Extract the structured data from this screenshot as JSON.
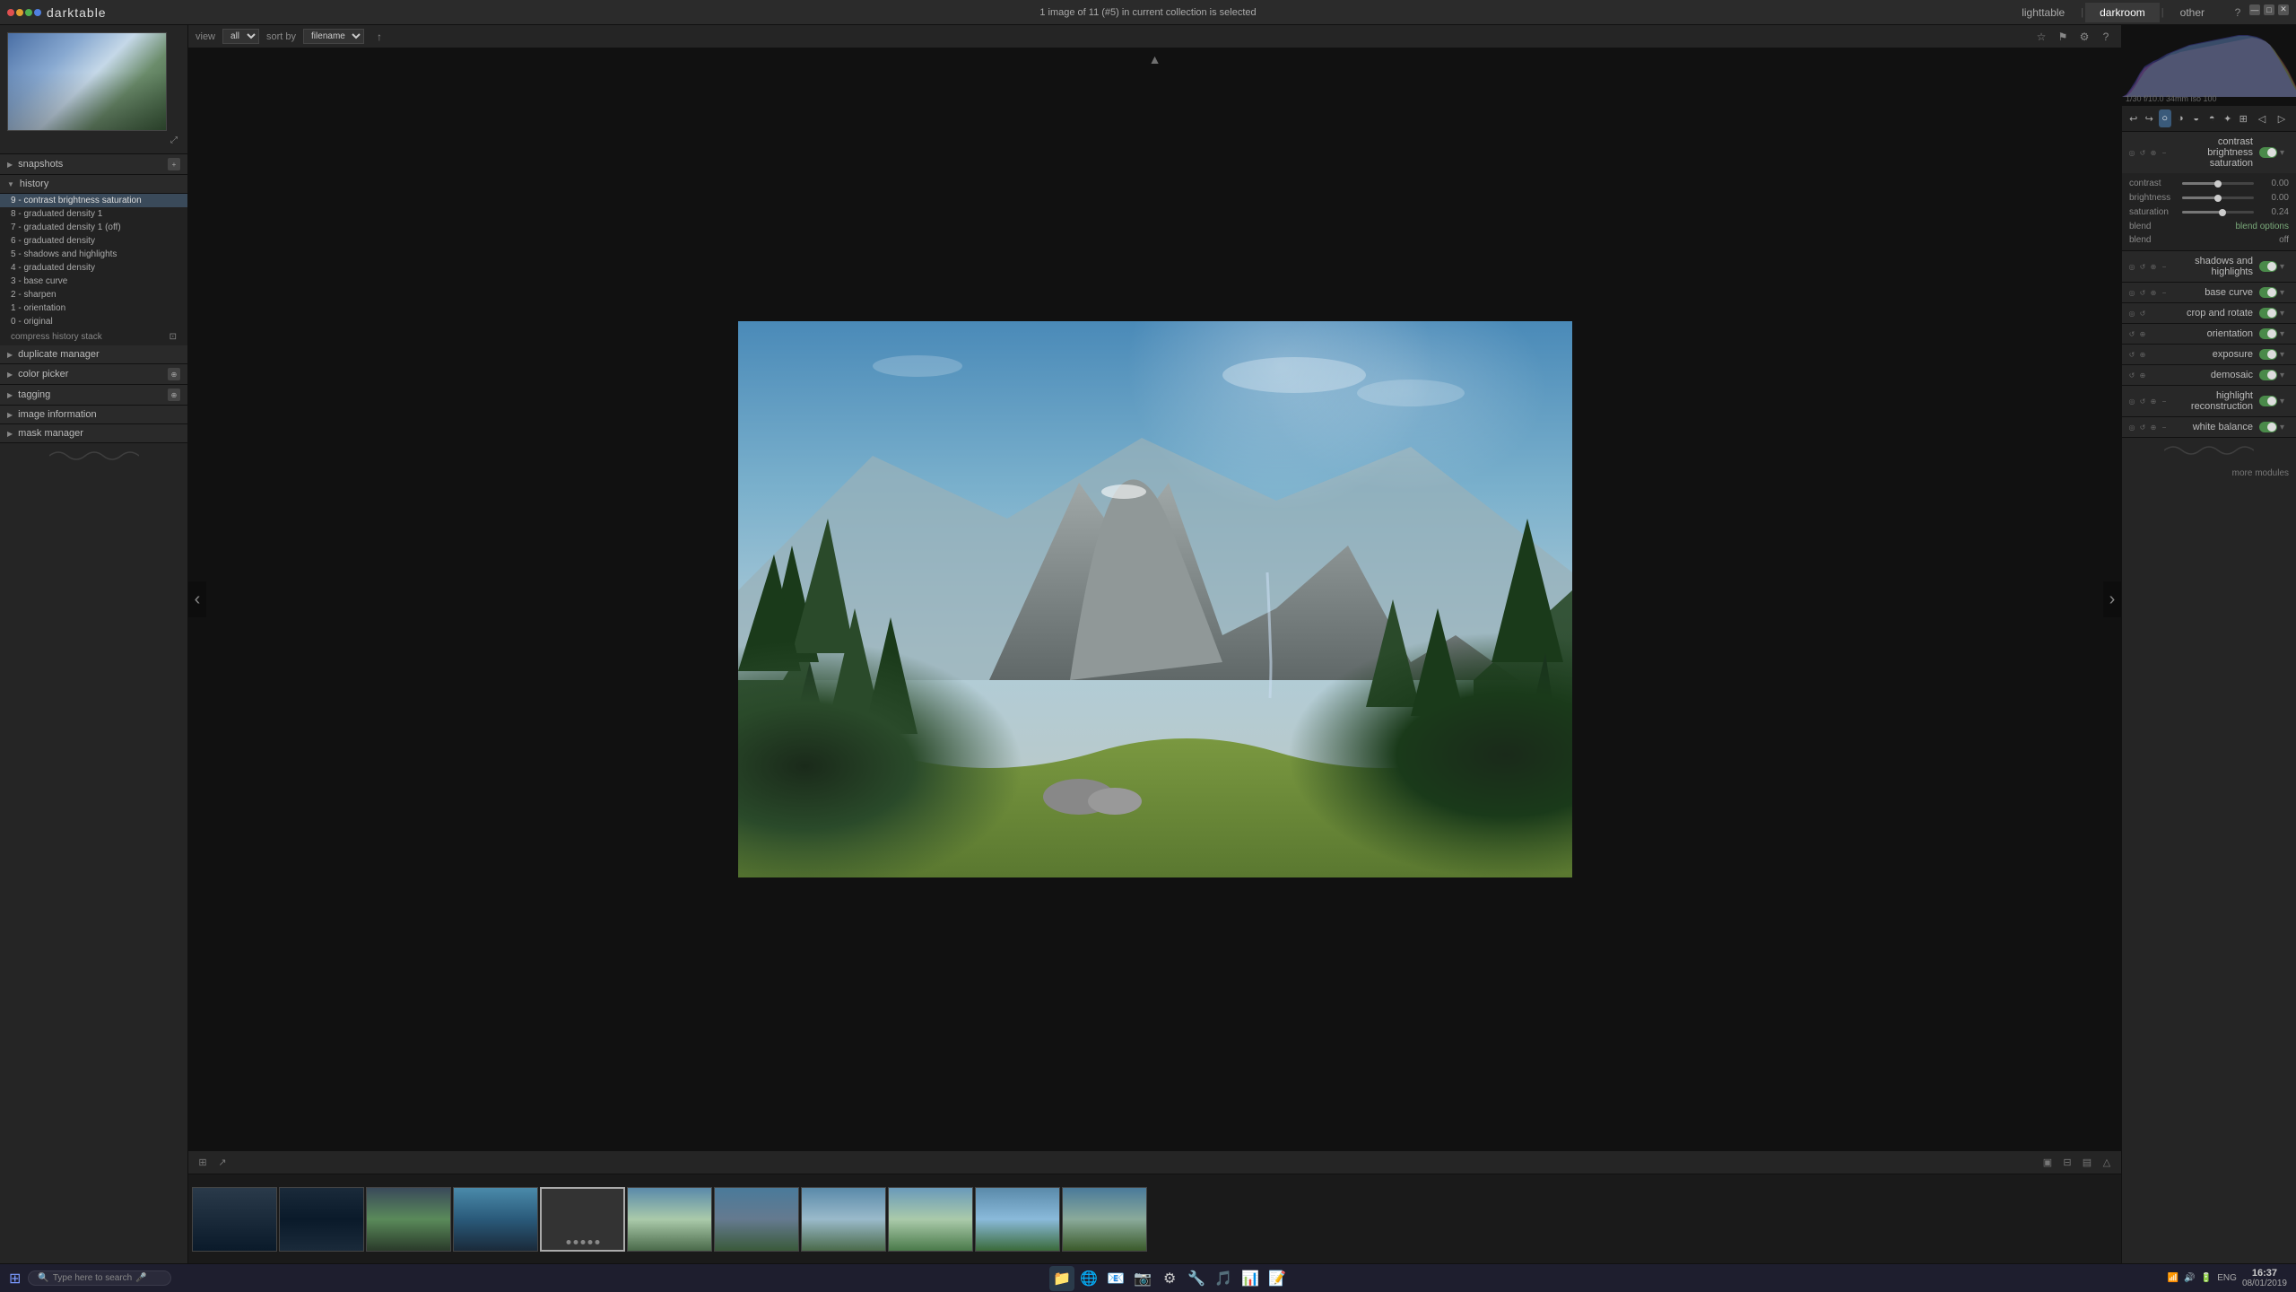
{
  "app": {
    "title": "darktable",
    "status_bar": "1 image of 11 (#5) in current collection is selected"
  },
  "nav": {
    "tabs": [
      {
        "id": "lighttable",
        "label": "lighttable"
      },
      {
        "id": "darkroom",
        "label": "darkroom",
        "active": true
      },
      {
        "id": "other",
        "label": "other"
      }
    ]
  },
  "view_toolbar": {
    "view_label": "view",
    "view_value": "all",
    "sortby_label": "sort by",
    "sortby_value": "filename",
    "sortby_dir": "↑"
  },
  "left_panel": {
    "snapshots_label": "snapshots",
    "history_label": "history",
    "history_items": [
      {
        "id": 9,
        "label": "9 - contrast brightness saturation",
        "active": true
      },
      {
        "id": 8,
        "label": "8 - graduated density 1"
      },
      {
        "id": 7,
        "label": "7 - graduated density 1 (off)"
      },
      {
        "id": 6,
        "label": "6 - graduated density"
      },
      {
        "id": 5,
        "label": "5 - shadows and highlights"
      },
      {
        "id": 4,
        "label": "4 - graduated density"
      },
      {
        "id": 3,
        "label": "3 - base curve"
      },
      {
        "id": 2,
        "label": "2 - sharpen"
      },
      {
        "id": 1,
        "label": "1 - orientation"
      },
      {
        "id": 0,
        "label": "0 - original"
      }
    ],
    "compress_history": "compress history stack",
    "duplicate_manager_label": "duplicate manager",
    "color_picker_label": "color picker",
    "tagging_label": "tagging",
    "image_information_label": "image information",
    "mask_manager_label": "mask manager"
  },
  "right_panel": {
    "histogram_info": "1/30 f/10.0 34mm iso 100",
    "module_active": "contrast brightness saturation",
    "sliders": {
      "contrast_label": "contrast",
      "contrast_value": "0.00",
      "contrast_pct": 50,
      "brightness_label": "brightness",
      "brightness_value": "0.00",
      "brightness_pct": 50,
      "saturation_label": "saturation",
      "saturation_value": "0.24",
      "saturation_pct": 56
    },
    "blend_label": "blend",
    "blend_options_label": "blend options",
    "blend_value": "off",
    "modules": [
      {
        "label": "shadows and highlights",
        "enabled": true
      },
      {
        "label": "base curve",
        "enabled": true
      },
      {
        "label": "crop and rotate",
        "enabled": true
      },
      {
        "label": "orientation",
        "enabled": true
      },
      {
        "label": "exposure",
        "enabled": true
      },
      {
        "label": "demosaic",
        "enabled": true
      },
      {
        "label": "highlight reconstruction",
        "enabled": true
      },
      {
        "label": "white balance",
        "enabled": true
      }
    ],
    "more_modules": "more modules"
  },
  "filmstrip": {
    "items": 11,
    "active_index": 5
  },
  "taskbar": {
    "search_placeholder": "Type here to search",
    "time": "16:37",
    "date": "08/01/2019",
    "lang": "ENG"
  }
}
